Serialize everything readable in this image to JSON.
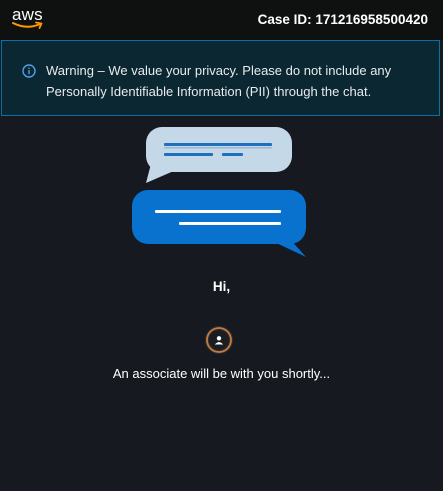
{
  "header": {
    "logo_text": "aws",
    "case_id": "Case ID: 171216958500420"
  },
  "notice": {
    "text": "Warning – We value your privacy. Please do not include any Personally Identifiable Information (PII) through the chat.",
    "icon": "info-icon"
  },
  "chat": {
    "greeting": "Hi,",
    "status": "An associate will be with you shortly...",
    "illustration": "chat-bubbles-icon",
    "avatar_icon": "user-icon"
  },
  "colors": {
    "background": "#16191f",
    "header": "#0f1111",
    "notice_background": "#0a2732",
    "notice_border": "#0972a5",
    "accent_blue": "#0972ce",
    "bubble_light": "#c5d8e8",
    "aws_orange": "#ff9900"
  }
}
